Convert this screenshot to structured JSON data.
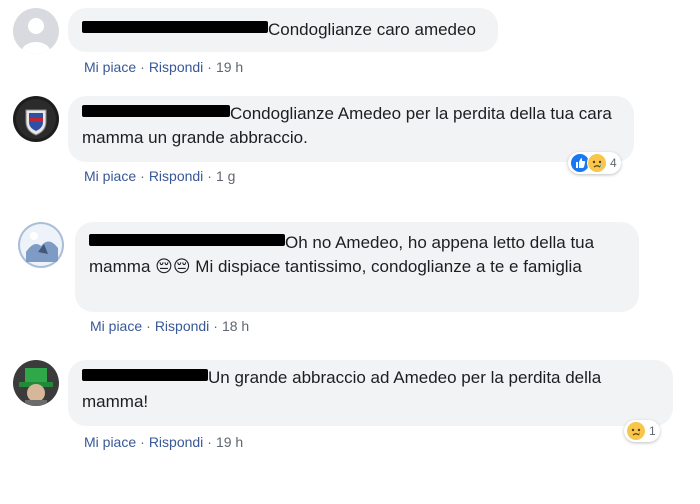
{
  "comments": [
    {
      "text": "Condoglianze caro amedeo",
      "like_label": "Mi piace",
      "reply_label": "Rispondi",
      "sep": "·",
      "time": "19 h",
      "reactions": null
    },
    {
      "text": "Condoglianze Amedeo per la perdita della tua cara mamma un grande abbraccio.",
      "like_label": "Mi piace",
      "reply_label": "Rispondi",
      "sep": "·",
      "time": "1 g",
      "reactions": {
        "icons": [
          "like-icon",
          "sad-icon"
        ],
        "count": "4"
      }
    },
    {
      "text_part1": "Oh no Amedeo, ho appena letto della tua mamma ",
      "emoji": "😔😔",
      "text_part2": " Mi dispiace tantissimo, condoglianze a te e famiglia",
      "like_label": "Mi piace",
      "reply_label": "Rispondi",
      "sep": "·",
      "time": "18 h",
      "reactions": null
    },
    {
      "text": "Un grande abbraccio ad Amedeo per la perdita della mamma!",
      "like_label": "Mi piace",
      "reply_label": "Rispondi",
      "sep": "·",
      "time": "19 h",
      "reactions": {
        "icons": [
          "sad-icon"
        ],
        "count": "1"
      }
    }
  ],
  "colors": {
    "bubble_bg": "#f2f3f5",
    "link": "#385898",
    "meta": "#606770",
    "like_blue": "#1877f2",
    "sad_yellow": "#f7c64a"
  }
}
